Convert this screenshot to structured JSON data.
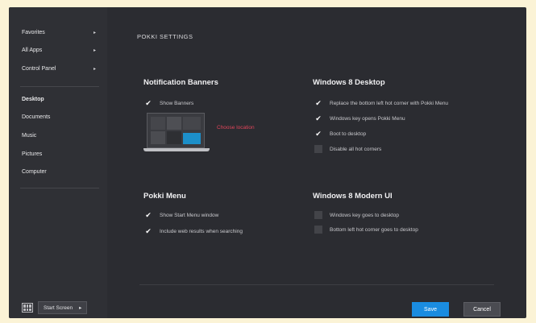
{
  "sidebar": {
    "menu_items": [
      {
        "label": "Favorites",
        "arrow": "▸"
      },
      {
        "label": "All Apps",
        "arrow": "▸"
      },
      {
        "label": "Control Panel",
        "arrow": "▸"
      }
    ],
    "places": [
      {
        "label": "Desktop"
      },
      {
        "label": "Documents"
      },
      {
        "label": "Music"
      },
      {
        "label": "Pictures"
      },
      {
        "label": "Computer"
      }
    ],
    "start_icon": "tiles-icon",
    "start_button_label": "Start Screen",
    "start_button_arrow": "▸"
  },
  "main": {
    "title": "POKKI SETTINGS",
    "notification": {
      "heading": "Notification Banners",
      "show_banners": {
        "label": "Show Banners",
        "checked": true
      },
      "choose_location": "Choose location"
    },
    "pokki_menu": {
      "heading": "Pokki Menu",
      "options": [
        {
          "label": "Show Start Menu window",
          "checked": true
        },
        {
          "label": "Include web results when searching",
          "checked": true
        }
      ]
    },
    "win8_desktop": {
      "heading": "Windows 8 Desktop",
      "options": [
        {
          "label": "Replace the bottom left hot corner with Pokki Menu",
          "checked": true
        },
        {
          "label": "Windows key opens Pokki Menu",
          "checked": true
        },
        {
          "label": "Boot to desktop",
          "checked": true
        },
        {
          "label": "Disable all hot corners",
          "checked": false
        }
      ]
    },
    "win8_modern": {
      "heading": "Windows 8 Modern UI",
      "options": [
        {
          "label": "Windows key goes to desktop",
          "checked": false
        },
        {
          "label": "Bottom left hot corner goes to desktop",
          "checked": false
        }
      ]
    },
    "save_label": "Save",
    "cancel_label": "Cancel"
  },
  "colors": {
    "accent": "#1a8ce0",
    "link": "#e0455a",
    "preview_highlight": "#1c8fc9"
  }
}
